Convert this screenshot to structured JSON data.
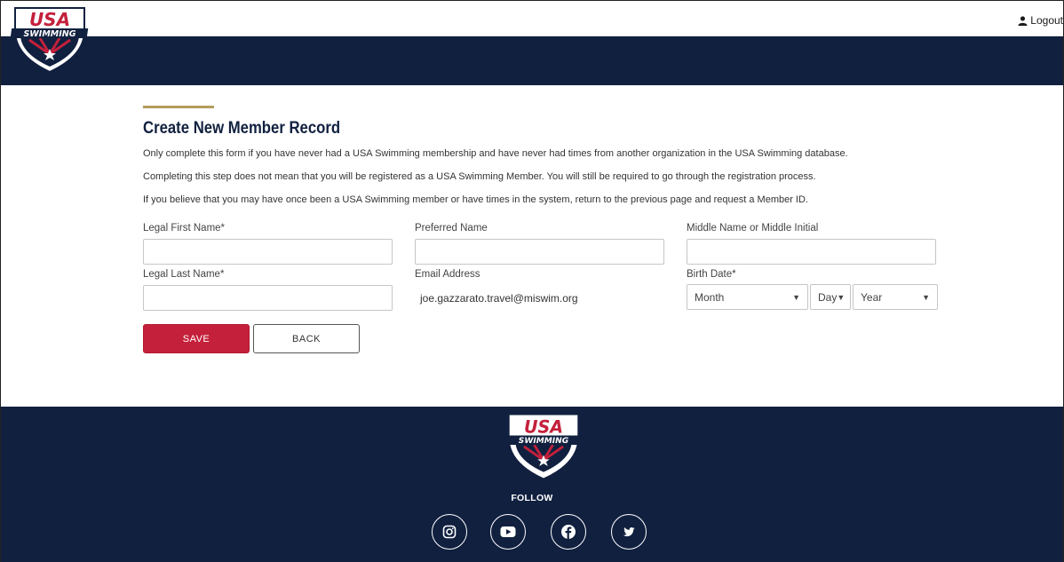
{
  "header": {
    "logo_text_top": "USA",
    "logo_text_bottom": "SWIMMING",
    "logout_label": "Logout",
    "logout_icon": "user-icon"
  },
  "form": {
    "title": "Create New Member Record",
    "paragraphs": [
      "Only complete this form if you have never had a USA Swimming membership and have never had times from another organization in the USA Swimming database.",
      "Completing this step does not mean that you will be registered as a USA Swimming Member. You will still be required to go through the registration process.",
      "If you believe that you may have once been a USA Swimming member or have times in the system, return to the previous page and request a Member ID."
    ],
    "fields": {
      "legal_first_name": {
        "label": "Legal First Name*",
        "value": ""
      },
      "preferred_name": {
        "label": "Preferred Name",
        "value": ""
      },
      "middle_name": {
        "label": "Middle Name or Middle Initial",
        "value": ""
      },
      "legal_last_name": {
        "label": "Legal Last Name*",
        "value": ""
      },
      "email": {
        "label": "Email Address",
        "value": "joe.gazzarato.travel@miswim.org"
      },
      "birth_date": {
        "label": "Birth Date*",
        "month": "Month",
        "day": "Day",
        "year": "Year"
      }
    },
    "save_label": "SAVE",
    "back_label": "BACK"
  },
  "footer": {
    "follow_label": "FOLLOW",
    "social": [
      "instagram-icon",
      "youtube-icon",
      "facebook-icon",
      "twitter-icon"
    ]
  },
  "colors": {
    "navy": "#11203f",
    "gold": "#b39b5b",
    "red": "#c4203b"
  }
}
